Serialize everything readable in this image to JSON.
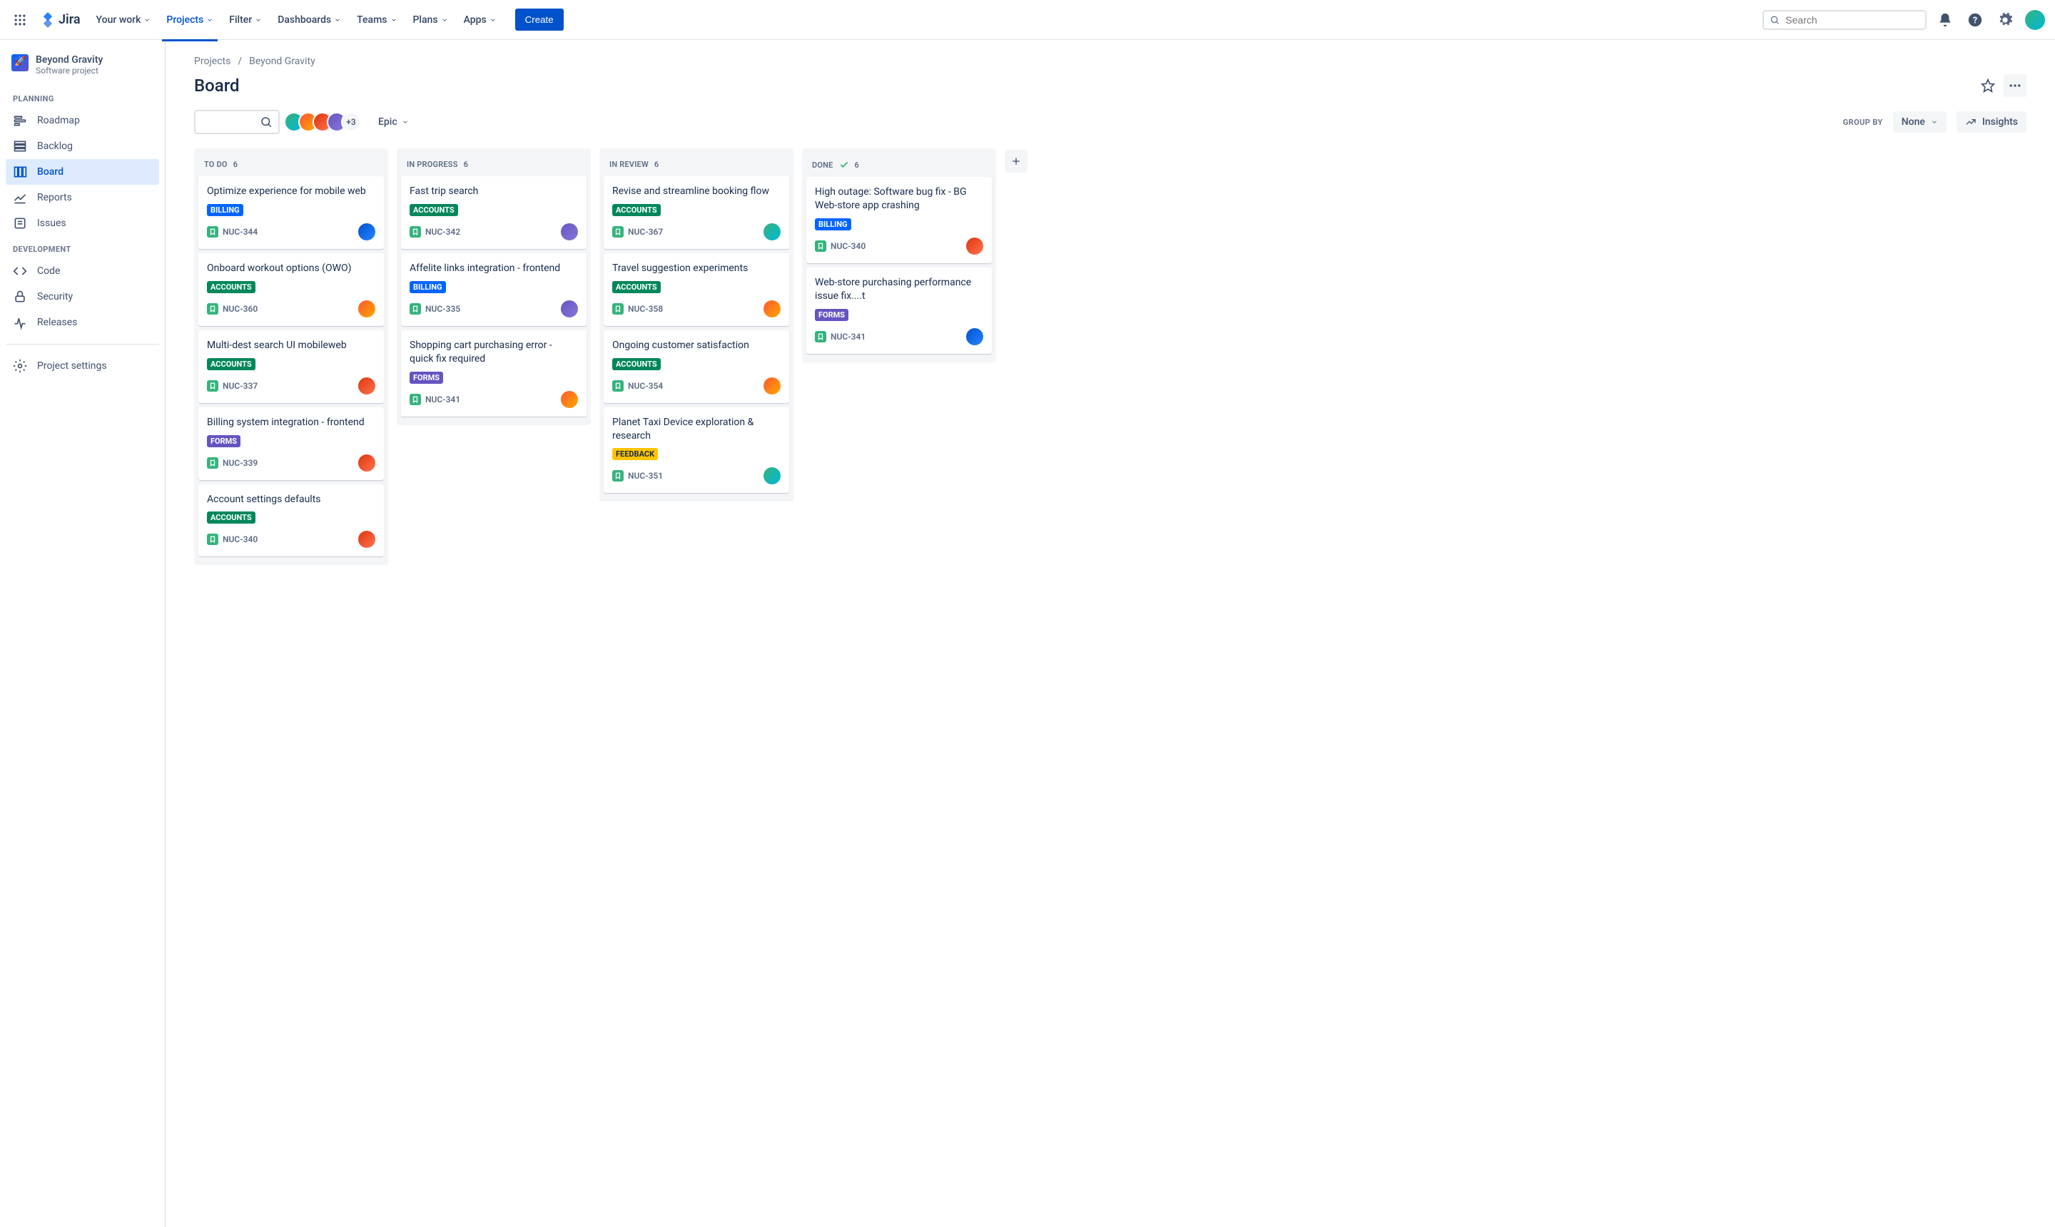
{
  "topnav": {
    "product": "Jira",
    "items": [
      "Your work",
      "Projects",
      "Filter",
      "Dashboards",
      "Teams",
      "Plans",
      "Apps"
    ],
    "active_index": 1,
    "create_label": "Create",
    "search_placeholder": "Search"
  },
  "sidebar": {
    "project_name": "Beyond Gravity",
    "project_type": "Software project",
    "sections": [
      {
        "label": "PLANNING",
        "items": [
          "Roadmap",
          "Backlog",
          "Board",
          "Reports",
          "Issues"
        ],
        "active_index": 2
      },
      {
        "label": "DEVELOPMENT",
        "items": [
          "Code",
          "Security",
          "Releases"
        ],
        "active_index": -1
      }
    ],
    "settings_label": "Project settings"
  },
  "breadcrumb": {
    "root": "Projects",
    "current": "Beyond Gravity"
  },
  "page_title": "Board",
  "toolbar": {
    "avatar_more": "+3",
    "epic_label": "Epic",
    "group_by_label": "GROUP BY",
    "group_by_value": "None",
    "insights_label": "Insights"
  },
  "columns": [
    {
      "name": "TO DO",
      "count": 6,
      "done": false,
      "cards": [
        {
          "title": "Optimize experience for mobile web",
          "tag": "BILLING",
          "key": "NUC-344",
          "assignee": 4
        },
        {
          "title": "Onboard workout options (OWO)",
          "tag": "ACCOUNTS",
          "key": "NUC-360",
          "assignee": 1
        },
        {
          "title": "Multi-dest search UI mobileweb",
          "tag": "ACCOUNTS",
          "key": "NUC-337",
          "assignee": 3
        },
        {
          "title": "Billing system integration - frontend",
          "tag": "FORMS",
          "key": "NUC-339",
          "assignee": 3
        },
        {
          "title": "Account settings defaults",
          "tag": "ACCOUNTS",
          "key": "NUC-340",
          "assignee": 3
        }
      ]
    },
    {
      "name": "IN PROGRESS",
      "count": 6,
      "done": false,
      "cards": [
        {
          "title": "Fast trip search",
          "tag": "ACCOUNTS",
          "key": "NUC-342",
          "assignee": 2
        },
        {
          "title": "Affelite links integration - frontend",
          "tag": "BILLING",
          "key": "NUC-335",
          "assignee": 2
        },
        {
          "title": "Shopping cart purchasing error - quick fix required",
          "tag": "FORMS",
          "key": "NUC-341",
          "assignee": 1
        }
      ]
    },
    {
      "name": "IN REVIEW",
      "count": 6,
      "done": false,
      "cards": [
        {
          "title": "Revise and streamline booking flow",
          "tag": "ACCOUNTS",
          "key": "NUC-367",
          "assignee": 0
        },
        {
          "title": "Travel suggestion experiments",
          "tag": "ACCOUNTS",
          "key": "NUC-358",
          "assignee": 1
        },
        {
          "title": "Ongoing customer satisfaction",
          "tag": "ACCOUNTS",
          "key": "NUC-354",
          "assignee": 1
        },
        {
          "title": "Planet Taxi Device exploration & research",
          "tag": "FEEDBACK",
          "key": "NUC-351",
          "assignee": 0
        }
      ]
    },
    {
      "name": "DONE",
      "count": 6,
      "done": true,
      "cards": [
        {
          "title": "High outage: Software bug fix - BG Web-store app crashing",
          "tag": "BILLING",
          "key": "NUC-340",
          "assignee": 3
        },
        {
          "title": "Web-store purchasing performance issue fix....t",
          "tag": "FORMS",
          "key": "NUC-341",
          "assignee": 4
        }
      ]
    }
  ]
}
